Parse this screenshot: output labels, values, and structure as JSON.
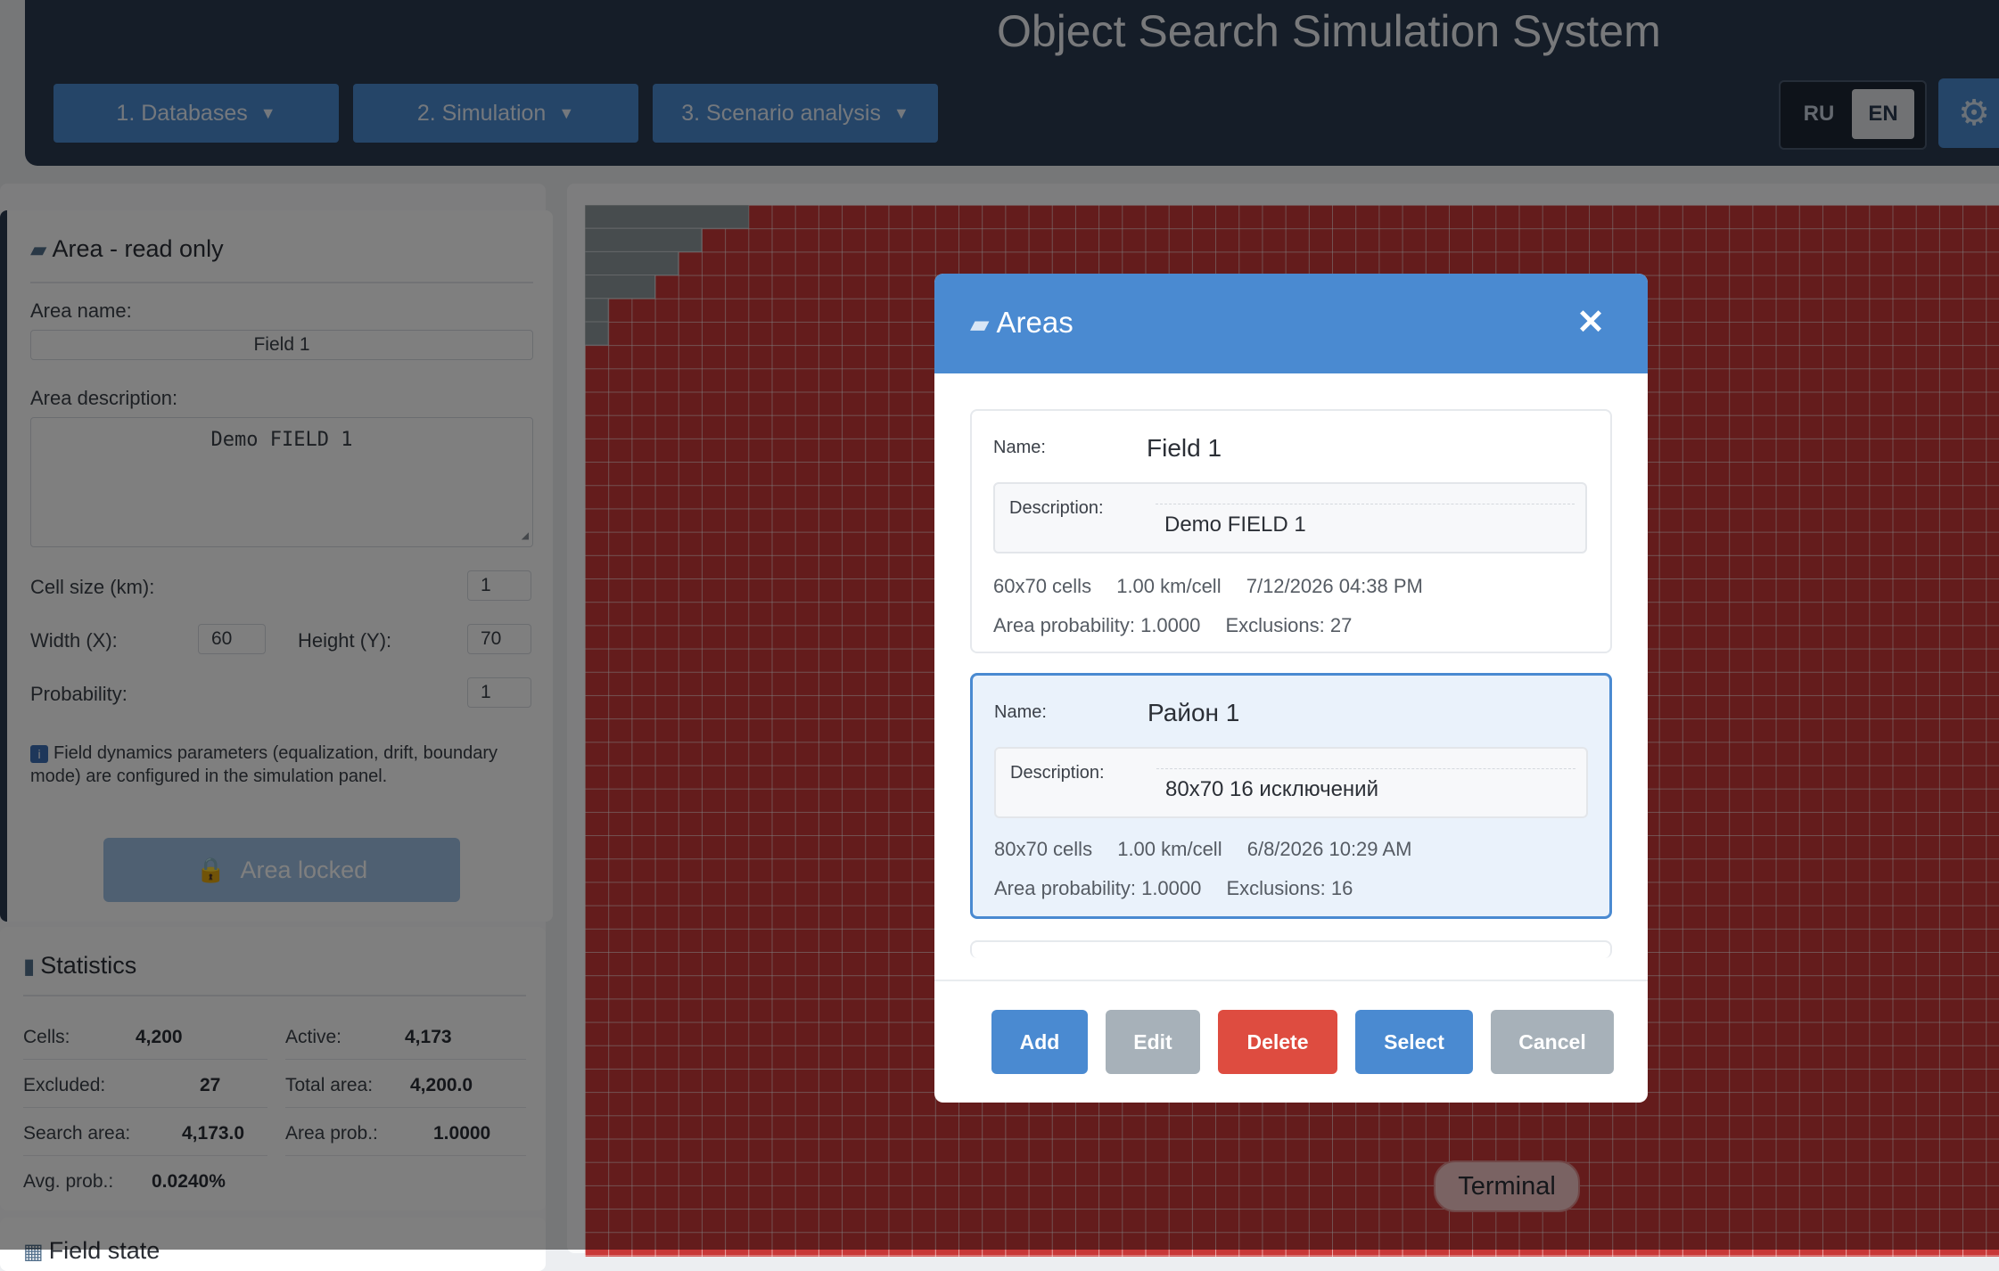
{
  "header": {
    "title": "Object Search Simulation System",
    "menu": [
      {
        "label": "1. Databases",
        "caret": "▼"
      },
      {
        "label": "2. Simulation",
        "caret": "▼"
      },
      {
        "label": "3. Scenario analysis",
        "caret": "▼"
      }
    ],
    "languages": [
      "RU",
      "EN"
    ],
    "active_language": "EN",
    "settings_icon": "gear-icon"
  },
  "area_panel": {
    "title": "Area - read only",
    "title_icon": "folder-icon",
    "name_label": "Area name:",
    "name_value": "Field 1",
    "description_label": "Area description:",
    "description_value": "Demo FIELD 1",
    "cell_size_label": "Cell size (km):",
    "cell_size_value": "1",
    "width_label": "Width (X):",
    "width_value": "60",
    "height_label": "Height (Y):",
    "height_value": "70",
    "probability_label": "Probability:",
    "probability_value": "1",
    "info_icon": "info-icon",
    "info_text": "Field dynamics parameters (equalization, drift, boundary mode) are configured in the simulation panel.",
    "locked_button": "Area locked",
    "lock_icon": "lock-icon"
  },
  "statistics": {
    "title": "Statistics",
    "title_icon": "bar-chart-icon",
    "cells_label": "Cells:",
    "cells_value": "4,200",
    "active_label": "Active:",
    "active_value": "4,173",
    "excluded_label": "Excluded:",
    "excluded_value": "27",
    "total_area_label": "Total area:",
    "total_area_value": "4,200.0",
    "search_area_label": "Search area:",
    "search_area_value": "4,173.0",
    "area_prob_label": "Area prob.:",
    "area_prob_value": "1.0000",
    "avg_prob_label": "Avg. prob.:",
    "avg_prob_value": "0.0240%"
  },
  "field_state": {
    "title": "Field state",
    "title_icon": "map-icon"
  },
  "grid": {
    "cell_color": "#c83838",
    "excluded_color": "#8f999c",
    "terminal_label": "Terminal"
  },
  "modal": {
    "title": "Areas",
    "title_icon": "folder-icon",
    "close_glyph": "✕",
    "areas": [
      {
        "name_label": "Name:",
        "name": "Field 1",
        "description_label": "Description:",
        "description": "Demo FIELD 1",
        "cells": "60x70 cells",
        "cell_size": "1.00 km/cell",
        "date": "7/12/2026 04:38 PM",
        "probability": "Area probability: 1.0000",
        "exclusions": "Exclusions: 27",
        "selected": false
      },
      {
        "name_label": "Name:",
        "name": "Район 1",
        "description_label": "Description:",
        "description": "80x70 16 исключений",
        "cells": "80x70 cells",
        "cell_size": "1.00 km/cell",
        "date": "6/8/2026 10:29 AM",
        "probability": "Area probability: 1.0000",
        "exclusions": "Exclusions: 16",
        "selected": true
      }
    ],
    "buttons": {
      "add": "Add",
      "edit": "Edit",
      "delete": "Delete",
      "select": "Select",
      "cancel": "Cancel"
    },
    "colors": {
      "primary": "#4a8ad1",
      "danger": "#de4c40",
      "neutral": "#a7b1b9"
    }
  }
}
